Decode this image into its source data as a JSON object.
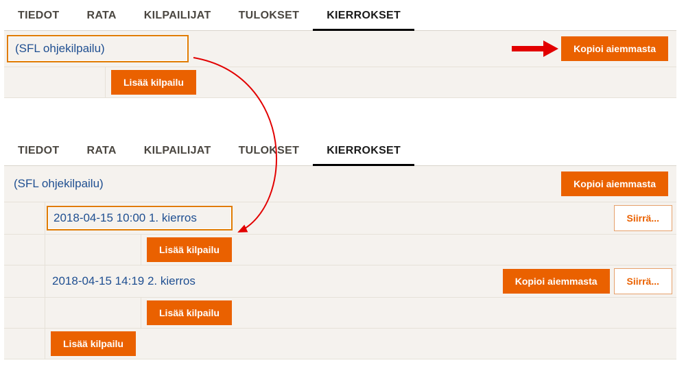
{
  "tabs": [
    "TIEDOT",
    "RATA",
    "KILPAILIJAT",
    "TULOKSET",
    "KIERROKSET"
  ],
  "activeTab": "KIERROKSET",
  "competitionTitle": "(SFL ohjekilpailu)",
  "buttons": {
    "copyPrev": "Kopioi aiemmasta",
    "addComp": "Lisää kilpailu",
    "move": "Siirrä..."
  },
  "bottom": {
    "rounds": [
      {
        "dt": "2018-04-15 10:00",
        "label": "1. kierros",
        "highlight": true,
        "showCopy": false
      },
      {
        "dt": "2018-04-15 14:19",
        "label": "2. kierros",
        "highlight": false,
        "showCopy": true
      }
    ]
  }
}
